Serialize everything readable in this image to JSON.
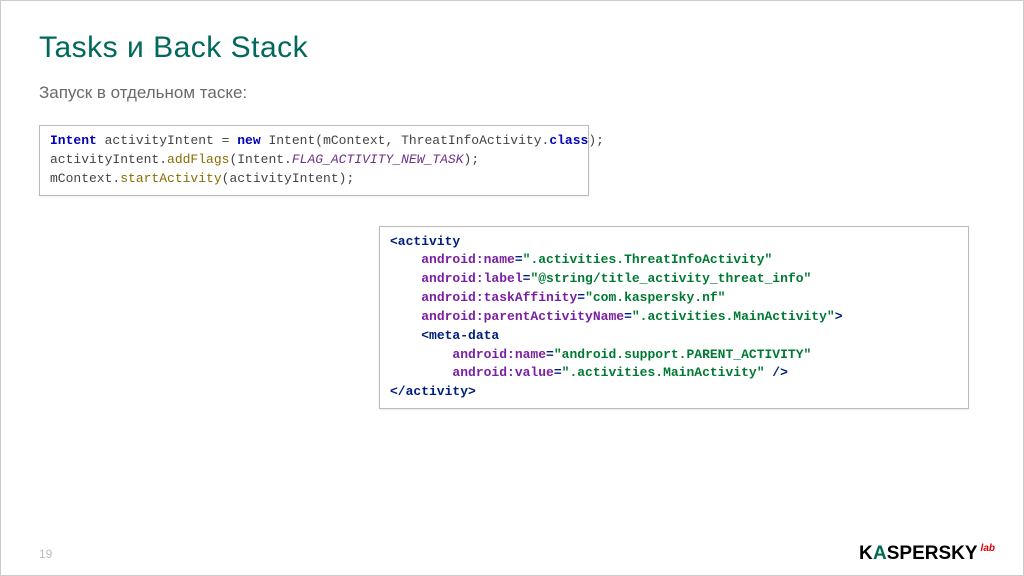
{
  "title": "Tasks и Back Stack",
  "subtitle": "Запуск в отдельном таске:",
  "page_number": "19",
  "logo": {
    "pre": "K",
    "mid_a": "A",
    "rest": "SPERSKY",
    "lab": "lab"
  },
  "java": {
    "kw_intent": "Intent",
    "var": "activityIntent",
    "eq": " = ",
    "kw_new": "new",
    "line1_rest": " Intent(mContext, ThreatInfoActivity.",
    "kw_class": "class",
    "line1_end": ");",
    "line2_pre": "activityIntent.",
    "method_add": "addFlags",
    "line2_mid": "(Intent.",
    "field_flag": "FLAG_ACTIVITY_NEW_TASK",
    "line2_end": ");",
    "line3_pre": "mContext.",
    "method_start": "startActivity",
    "line3_end": "(activityIntent);"
  },
  "xml": {
    "open_activity": "<activity",
    "attr_name": "android:name",
    "val_name": "\".activities.ThreatInfoActivity\"",
    "attr_label": "android:label",
    "val_label": "\"@string/title_activity_threat_info\"",
    "attr_affinity": "android:taskAffinity",
    "val_affinity": "\"com.kaspersky.nf\"",
    "attr_parent": "android:parentActivityName",
    "val_parent": "\".activities.MainActivity\"",
    "gt": ">",
    "open_meta": "<meta-data",
    "meta_attr_name": "android:name",
    "meta_val_name": "\"android.support.PARENT_ACTIVITY\"",
    "meta_attr_value": "android:value",
    "meta_val_value": "\".activities.MainActivity\"",
    "meta_close": " />",
    "close_activity": "</activity>"
  }
}
